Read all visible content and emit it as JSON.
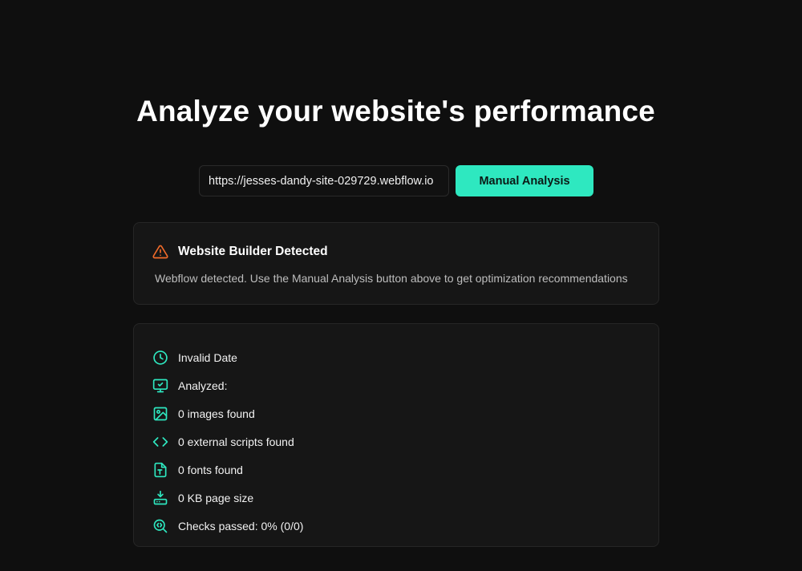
{
  "header": {
    "title": "Analyze your website's performance"
  },
  "search": {
    "url_value": "https://jesses-dandy-site-029729.webflow.io",
    "button_label": "Manual Analysis"
  },
  "alert": {
    "icon": "warning-icon",
    "title": "Website Builder Detected",
    "message": "Webflow detected. Use the Manual Analysis button above to get optimization recommendations"
  },
  "stats": {
    "items": [
      {
        "icon": "clock-icon",
        "text": "Invalid Date"
      },
      {
        "icon": "monitor-check-icon",
        "text": "Analyzed:"
      },
      {
        "icon": "image-icon",
        "text": "0 images found"
      },
      {
        "icon": "code-icon",
        "text": "0 external scripts found"
      },
      {
        "icon": "font-file-icon",
        "text": "0 fonts found"
      },
      {
        "icon": "download-drive-icon",
        "text": "0 KB page size"
      },
      {
        "icon": "search-check-icon",
        "text": "Checks passed: 0% (0/0)"
      }
    ]
  },
  "colors": {
    "background": "#0f0f0f",
    "accent": "#2ee8c0",
    "warning": "#f26b2a",
    "card": "#161616"
  }
}
